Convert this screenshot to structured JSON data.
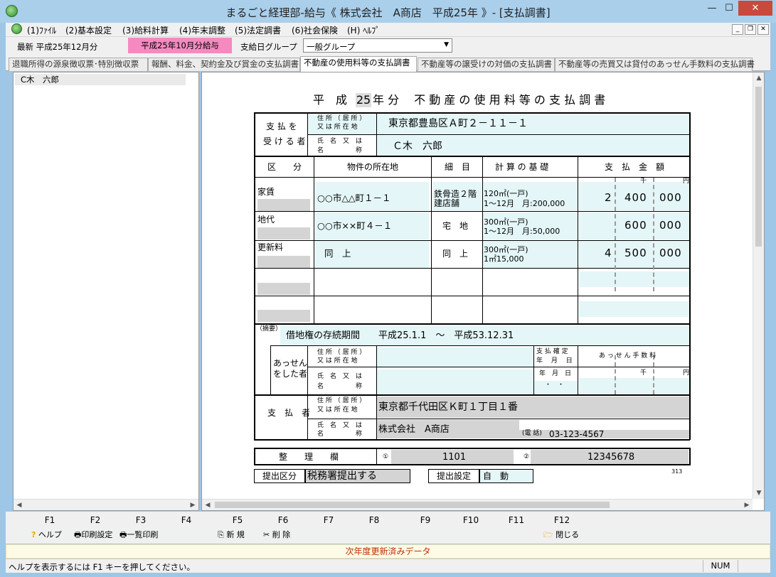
{
  "window": {
    "title": "まるごと経理部-給与《 株式会社　A商店　平成25年 》- [支払調書]",
    "min": "—",
    "max": "☐",
    "close": "✕"
  },
  "menu": {
    "items": [
      "(1)ﾌｧｲﾙ",
      "(2)基本設定",
      "(3)給料計算",
      "(4)年末調整",
      "(5)法定調書",
      "(6)社会保険",
      "(H) ﾍﾙﾌﾟ"
    ],
    "mdi_min": "_",
    "mdi_restore": "❐",
    "mdi_close": "✕"
  },
  "toolbar": {
    "latest": "最新 平成25年12月分",
    "period_badge": "平成25年10月分給与",
    "group_label": "支給日グループ",
    "group_value": "一般グループ"
  },
  "tabs": [
    "退職所得の源泉徴収票･特別徴収票",
    "報酬、料金、契約金及び賞金の支払調書",
    "不動産の使用料等の支払調書",
    "不動産等の譲受けの対価の支払調書",
    "不動産等の売買又は貸付のあっせん手数料の支払調書"
  ],
  "left": {
    "selected": "C木　六郎"
  },
  "form": {
    "title_prefix": "平　成",
    "year": "25",
    "title_suffix": "年 分　 不 動 産 の 使 用 料 等 の 支 払 調 書",
    "recipient_label1": "支 払 を",
    "recipient_label2": "受 け る 者",
    "addr_label1": "住 所 （ 居 所 ）",
    "addr_label2": "又 は 所 在 地",
    "name_label1": "氏　名　又　は",
    "name_label2": "名　　　　　称",
    "recipient_addr": "東京都豊島区Ａ町２－１１－１",
    "recipient_name": "Ｃ木　六郎",
    "h_kubun": "区　　分",
    "h_loc": "物件の所在地",
    "h_detail": "細　目",
    "h_basis": "計 算 の 基 礎",
    "h_amount": "支　払　金　額",
    "unit_sen": "千",
    "unit_en": "円",
    "rows": [
      {
        "kubun": "家賃",
        "loc": "○○市△△町１－１",
        "detail1": "鉄骨造２階",
        "detail2": "建店舗",
        "basis1": "120㎡(一戸)",
        "basis2": "1～12月　月:200,000",
        "a1": "2",
        "a2": "400",
        "a3": "000"
      },
      {
        "kubun": "地代",
        "loc": "○○市××町４－１",
        "detail1": "宅　地",
        "detail2": "",
        "basis1": "300㎡(一戸)",
        "basis2": "1～12月　月:50,000",
        "a1": "",
        "a2": "600",
        "a3": "000"
      },
      {
        "kubun": "更新料",
        "loc": "同　上",
        "detail1": "同　上",
        "detail2": "",
        "basis1": "300㎡(一戸)",
        "basis2": "1㎡15,000",
        "a1": "4",
        "a2": "500",
        "a3": "000"
      }
    ],
    "tekiyo_label": "（摘要）",
    "tekiyo": "借地権の存続期間　　平成25.1.1　～　平成53.12.31",
    "broker_label1": "あっせん",
    "broker_label2": "をした者",
    "paydate_label1": "支 払 確 定",
    "paydate_label2": "年　 月 　日",
    "fee_label": "あ っ せ ん 手 数 料",
    "ymd": "年　月　日",
    "dots": "・　・",
    "payer_label": "支　払　者",
    "payer_addr": "東京都千代田区Ｋ町１丁目１番",
    "payer_name": "株式会社　A商店",
    "phone_label": "(電 話)",
    "phone": "03-123-4567",
    "seiri_label": "整　　理　　欄",
    "seiri_no1": "①",
    "seiri_val1": "1101",
    "seiri_no2": "②",
    "seiri_val2": "12345678",
    "submit_label": "提出区分",
    "submit_value": "税務署提出する",
    "setting_label": "提出設定",
    "setting_value": "自　動",
    "code": "313"
  },
  "fkeys": [
    "F1",
    "F2",
    "F3",
    "F4",
    "F5",
    "F6",
    "F7",
    "F8",
    "F9",
    "F10",
    "F11",
    "F12"
  ],
  "fkey_labels": {
    "help": "ヘルプ",
    "print_setting": "印刷設定",
    "list_print": "一覧印刷",
    "new": "新 規",
    "delete": "削 除",
    "close": "閉じる"
  },
  "message": "次年度更新済みデータ",
  "status": {
    "text": "ヘルプを表示するには F1 キーを押してください。",
    "num": "NUM"
  },
  "colors": {
    "titlebar": "#a9cfeb",
    "badge": "#f58ac0",
    "cyan": "#e4f6f7",
    "close": "#c74a3c",
    "message": "#c03000"
  }
}
